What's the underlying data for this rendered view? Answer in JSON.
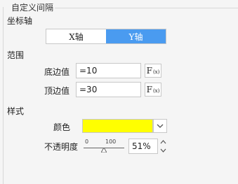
{
  "group_title": "自定义间隔",
  "axis": {
    "label": "坐标轴",
    "options": [
      "X轴",
      "Y轴"
    ],
    "selected": "Y轴"
  },
  "range": {
    "label": "范围",
    "bottom_label": "底边值",
    "bottom_value": "=10",
    "top_label": "顶边值",
    "top_value": "=30",
    "fx_label": "F",
    "fx_sub": "(x)"
  },
  "style": {
    "label": "样式",
    "color_label": "颜色",
    "color_value": "#ffff00",
    "opacity_label": "不透明度",
    "slider_min": "0",
    "slider_max": "100",
    "opacity_value": "51%"
  },
  "icons": {
    "dropdown": "chevron-down-icon",
    "spinner_up": "chevron-up-icon",
    "spinner_down": "chevron-down-icon"
  }
}
